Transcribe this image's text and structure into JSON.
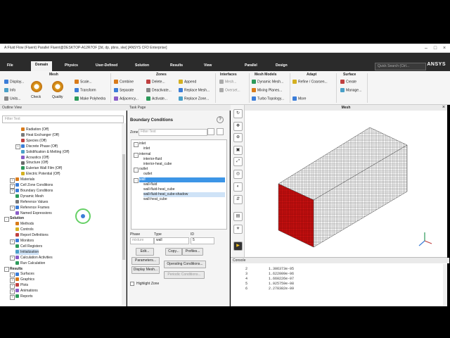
{
  "window": {
    "title": "A:Fluid Flow (Fluent) Parallel Fluent@DESKTOP-A12R7OF [3d, dp, pbns, ske] [ANSYS CFD Enterprise]",
    "quick_access": [
      "?",
      "?",
      "?",
      "?"
    ]
  },
  "tabs": [
    {
      "label": "File",
      "active": false
    },
    {
      "label": "Domain",
      "active": true
    },
    {
      "label": "Physics",
      "active": false
    },
    {
      "label": "User-Defined",
      "active": false
    },
    {
      "label": "Solution",
      "active": false
    },
    {
      "label": "Results",
      "active": false
    },
    {
      "label": "View",
      "active": false
    },
    {
      "label": "Parallel",
      "active": false
    },
    {
      "label": "Design",
      "active": false
    }
  ],
  "search_placeholder": "Quick Search (Ctrl...",
  "brand": "ANSYS",
  "ribbon": {
    "mesh": {
      "title": "Mesh",
      "display": "Display...",
      "info": "Info",
      "units": "Units...",
      "check": "Check",
      "quality": "Quality"
    },
    "scale": {
      "scale": "Scale...",
      "transform": "Transform",
      "make_polyhedra": "Make Polyhedra"
    },
    "zones": {
      "title": "Zones",
      "combine": "Combine",
      "separate": "Separate",
      "adjacency": "Adjacency...",
      "delete": "Delete...",
      "deactivate": "Deactivate...",
      "activate": "Activate...",
      "append": "Append",
      "replace_mesh": "Replace Mesh...",
      "replace_zone": "Replace Zone..."
    },
    "interfaces": {
      "title": "Interfaces",
      "mesh": "Mesh...",
      "overset": "Overset..."
    },
    "mesh_models": {
      "title": "Mesh Models",
      "dynamic_mesh": "Dynamic Mesh...",
      "mixing_planes": "Mixing Planes...",
      "turbo_topology": "Turbo Topology..."
    },
    "adapt": {
      "title": "Adapt",
      "refine_coarsen": "Refine / Coarsen...",
      "more": "More"
    },
    "surface": {
      "title": "Surface",
      "create": "Create",
      "manage": "Manage..."
    }
  },
  "outline": {
    "header": "Outline View",
    "filter_placeholder": "Filter Text",
    "items": [
      {
        "label": "Radiation (Off)",
        "indent": 2,
        "expander": "",
        "bold": false,
        "sel": false,
        "color": "#d97b1a"
      },
      {
        "label": "Heat Exchanger (Off)",
        "indent": 2,
        "expander": "",
        "bold": false,
        "sel": false,
        "color": "#7a7a7a"
      },
      {
        "label": "Species (Off)",
        "indent": 2,
        "expander": "",
        "bold": false,
        "sel": false,
        "color": "#c04040"
      },
      {
        "label": "Discrete Phase (Off)",
        "indent": 2,
        "expander": "+",
        "bold": false,
        "sel": false,
        "color": "#3b7dd8"
      },
      {
        "label": "Solidification & Melting (Off)",
        "indent": 2,
        "expander": "",
        "bold": false,
        "sel": false,
        "color": "#4aa0c8"
      },
      {
        "label": "Acoustics (Off)",
        "indent": 2,
        "expander": "",
        "bold": false,
        "sel": false,
        "color": "#8a5cc8"
      },
      {
        "label": "Structure (Off)",
        "indent": 2,
        "expander": "",
        "bold": false,
        "sel": false,
        "color": "#6b6b6b"
      },
      {
        "label": "Eulerian Wall Film (Off)",
        "indent": 2,
        "expander": "",
        "bold": false,
        "sel": false,
        "color": "#2c9a5a"
      },
      {
        "label": "Electric Potential (Off)",
        "indent": 2,
        "expander": "",
        "bold": false,
        "sel": false,
        "color": "#d4b020"
      },
      {
        "label": "Materials",
        "indent": 1,
        "expander": "+",
        "bold": false,
        "sel": false,
        "color": "#d97b1a"
      },
      {
        "label": "Cell Zone Conditions",
        "indent": 1,
        "expander": "+",
        "bold": false,
        "sel": false,
        "color": "#3b7dd8"
      },
      {
        "label": "Boundary Conditions",
        "indent": 1,
        "expander": "+",
        "bold": false,
        "sel": false,
        "color": "#3b7dd8"
      },
      {
        "label": "Dynamic Mesh",
        "indent": 1,
        "expander": "",
        "bold": false,
        "sel": false,
        "color": "#2c9a5a"
      },
      {
        "label": "Reference Values",
        "indent": 1,
        "expander": "",
        "bold": false,
        "sel": false,
        "color": "#7a7a7a"
      },
      {
        "label": "Reference Frames",
        "indent": 1,
        "expander": "+",
        "bold": false,
        "sel": false,
        "color": "#3b7dd8"
      },
      {
        "label": "Named Expressions",
        "indent": 1,
        "expander": "",
        "bold": false,
        "sel": false,
        "color": "#8a5cc8"
      },
      {
        "label": "Solution",
        "indent": 0,
        "expander": "-",
        "bold": true,
        "sel": false,
        "color": ""
      },
      {
        "label": "Methods",
        "indent": 1,
        "expander": "",
        "bold": false,
        "sel": false,
        "color": "#d97b1a"
      },
      {
        "label": "Controls",
        "indent": 1,
        "expander": "",
        "bold": false,
        "sel": false,
        "color": "#d4b020"
      },
      {
        "label": "Report Definitions",
        "indent": 1,
        "expander": "",
        "bold": false,
        "sel": false,
        "color": "#c04040"
      },
      {
        "label": "Monitors",
        "indent": 1,
        "expander": "+",
        "bold": false,
        "sel": false,
        "color": "#3b7dd8"
      },
      {
        "label": "Cell Registers",
        "indent": 1,
        "expander": "",
        "bold": false,
        "sel": false,
        "color": "#2c9a5a"
      },
      {
        "label": "Initialization",
        "indent": 1,
        "expander": "",
        "bold": false,
        "sel": true,
        "color": "#4aa0c8"
      },
      {
        "label": "Calculation Activities",
        "indent": 1,
        "expander": "+",
        "bold": false,
        "sel": false,
        "color": "#8a5cc8"
      },
      {
        "label": "Run Calculation",
        "indent": 1,
        "expander": "",
        "bold": false,
        "sel": false,
        "color": "#2c9a5a"
      },
      {
        "label": "Results",
        "indent": 0,
        "expander": "-",
        "bold": true,
        "sel": false,
        "color": ""
      },
      {
        "label": "Surfaces",
        "indent": 1,
        "expander": "+",
        "bold": false,
        "sel": false,
        "color": "#3b7dd8"
      },
      {
        "label": "Graphics",
        "indent": 1,
        "expander": "+",
        "bold": false,
        "sel": false,
        "color": "#d97b1a"
      },
      {
        "label": "Plots",
        "indent": 1,
        "expander": "+",
        "bold": false,
        "sel": false,
        "color": "#c04040"
      },
      {
        "label": "Animations",
        "indent": 1,
        "expander": "+",
        "bold": false,
        "sel": false,
        "color": "#8a5cc8"
      },
      {
        "label": "Reports",
        "indent": 1,
        "expander": "+",
        "bold": false,
        "sel": false,
        "color": "#2c9a5a"
      }
    ]
  },
  "task_page": {
    "header": "Task Page",
    "title": "Boundary Conditions",
    "zone_label": "Zone",
    "filter_placeholder": "Filter Text",
    "zones": [
      {
        "label": "inlet",
        "indent": 0,
        "expander": "-",
        "style": ""
      },
      {
        "label": "inlet",
        "indent": 1,
        "expander": "",
        "style": ""
      },
      {
        "label": "internal",
        "indent": 0,
        "expander": "-",
        "style": ""
      },
      {
        "label": "interior-fluid",
        "indent": 1,
        "expander": "",
        "style": ""
      },
      {
        "label": "interior-heat_cube",
        "indent": 1,
        "expander": "",
        "style": ""
      },
      {
        "label": "outlet",
        "indent": 0,
        "expander": "-",
        "style": ""
      },
      {
        "label": "outlet",
        "indent": 1,
        "expander": "",
        "style": ""
      },
      {
        "label": "wall",
        "indent": 0,
        "expander": "-",
        "style": "hl"
      },
      {
        "label": "wall-fluid",
        "indent": 1,
        "expander": "",
        "style": ""
      },
      {
        "label": "wall-fluid-heat_cube",
        "indent": 1,
        "expander": "",
        "style": ""
      },
      {
        "label": "wall-fluid-heat_cube-shadow",
        "indent": 1,
        "expander": "",
        "style": "sel"
      },
      {
        "label": "wall-heat_cube",
        "indent": 1,
        "expander": "",
        "style": ""
      }
    ],
    "phase_label": "Phase",
    "phase_value": "mixture",
    "type_label": "Type",
    "type_value": "wall",
    "id_label": "ID",
    "id_value": "5",
    "edit": "Edit...",
    "copy": "Copy...",
    "profiles": "Profiles...",
    "parameters": "Parameters...",
    "operating_conditions": "Operating Conditions...",
    "display_mesh": "Display Mesh...",
    "periodic_conditions": "Periodic Conditions...",
    "highlight_zone": "Highlight Zone"
  },
  "mesh_view": {
    "title": "Mesh"
  },
  "console": {
    "title": "Console",
    "lines": [
      "     2          1.306373e-05",
      "     3          1.622009e-06",
      "     4          1.660226e-07",
      "     5          1.925759e-08",
      "     6          2.278382e-09"
    ]
  },
  "colors": {
    "ribbon_dark": "#2b2b2b",
    "selection": "#cfe3f7",
    "highlight": "#3d95e6",
    "mesh_red": "#c41010"
  }
}
